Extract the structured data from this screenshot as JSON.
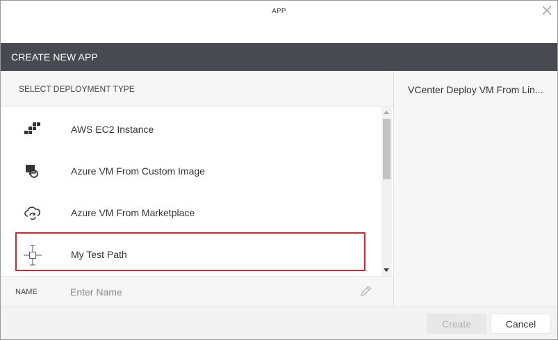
{
  "window": {
    "title": "APP",
    "close_icon": "close-icon"
  },
  "header": {
    "title": "CREATE NEW APP"
  },
  "deployment": {
    "heading": "SELECT DEPLOYMENT TYPE",
    "items": [
      {
        "label": "AWS EC2 Instance",
        "icon": "aws-icon",
        "selected": false
      },
      {
        "label": "Azure VM From Custom Image",
        "icon": "custom-image-icon",
        "selected": false
      },
      {
        "label": "Azure VM From Marketplace",
        "icon": "cloud-sync-icon",
        "selected": false
      },
      {
        "label": "My Test Path",
        "icon": "path-node-icon",
        "selected": true
      }
    ]
  },
  "name_field": {
    "label": "NAME",
    "placeholder": "Enter Name",
    "value": "",
    "icon": "pencil-icon"
  },
  "details": {
    "title": "VCenter Deploy VM From Lin..."
  },
  "footer": {
    "create_label": "Create",
    "cancel_label": "Cancel"
  },
  "colors": {
    "header_bg": "#474a51",
    "selection_border": "#c8282e",
    "panel_bg": "#f6f6f7"
  }
}
